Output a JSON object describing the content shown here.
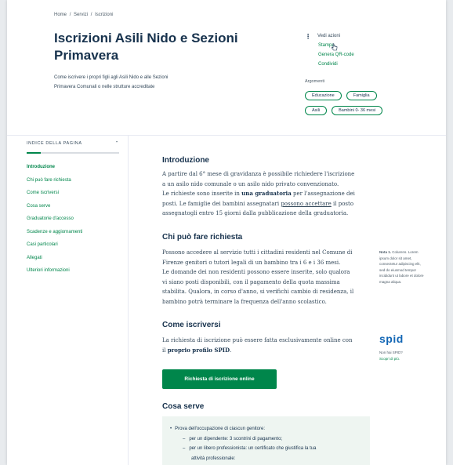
{
  "breadcrumb": [
    "Home",
    "/",
    "Servizi",
    "/",
    "Iscrizioni"
  ],
  "page": {
    "title": "Iscrizioni Asili Nido e Sezioni Primavera",
    "lead_line1": "Come iscrivere i propri figli agli Asili Nido e alle Sezioni",
    "lead_line2": "Primavera Comunali o nelle strutture accreditate"
  },
  "actions": {
    "menu_label": "Vedi azioni",
    "items": [
      "Stampa",
      "Genera QR-code",
      "Condividi"
    ]
  },
  "arguments": {
    "label": "Argomenti",
    "chips_row1": [
      "Educazione",
      "Famiglia"
    ],
    "chips_row2": [
      "Asili",
      "Bambini 0- 36 mesi"
    ]
  },
  "toc": {
    "title": "INDICE DELLA PAGINA",
    "progress": 0.15,
    "items": [
      "Introduzione",
      "Chi può fare richiesta",
      "Come iscriversi",
      "Cosa serve",
      "Graduatorie d'accesso",
      "Scadenze e aggiornamenti",
      "Casi particolari",
      "Allegati",
      "Ulteriori informazioni"
    ]
  },
  "sections": {
    "intro": {
      "heading": "Introduzione",
      "l1": "A partire dal 6° mese di gravidanza è possibile richiedere l'iscrizione",
      "l2": "a un asilo nido comunale o un asilo nido privato convenzionato.",
      "l3a": "Le richieste sono inserite in ",
      "l3b": "una graduatoria",
      "l3c": " per l'assegnazione dei",
      "l4a": "posti. Le famiglie dei bambini assegnatari ",
      "l4b": "possono accettare",
      "l4c": " il posto",
      "l5": "assegnatogli entro 15 giorni dalla pubblicazione della graduatoria."
    },
    "who": {
      "heading": "Chi può fare richiesta",
      "l1": "Possono accedere al servizio tutti i cittadini residenti nel Comune di",
      "l2": "Firenze genitori o tutori legali di un bambino tra i 6 e i 36 mesi.",
      "l3": "Le domande dei non residenti possono essere inserite, solo qualora",
      "l4": "vi siano posti disponibili, con il pagamento della quota massima",
      "l5": "stabilita. Qualora, in corso d'anno, si verifichi cambio di residenza, il",
      "l6": "bambino potrà terminare la frequenza dell'anno scolastico."
    },
    "how": {
      "heading": "Come iscriversi",
      "l1": "La richiesta di iscrizione può essere fatta esclusivamente online con",
      "l2a": "il ",
      "l2b": "proprio profilo SPID",
      "l2c": ".",
      "button": "Richiesta di iscrizione online"
    },
    "need": {
      "heading": "Cosa serve",
      "l1": "Prova dell'occupazione di ciascun genitore:",
      "l2": "per un dipendente: 3 scontrini di pagamento;",
      "l3": "per un libero professionista: un certificato che giustifica la tua",
      "l4": "attività professionale:"
    }
  },
  "note": {
    "l1a": "Nota 1.",
    "l1b": " Colurens. Lorem",
    "l2": "ipsum dolor sit amet,",
    "l3": "consectetur adipiscing elit,",
    "l4": "sed do eiusmod tempor",
    "l5": "incididunt ut labore et dolore",
    "l6": "magna aliqua."
  },
  "spid": {
    "logo": "spid",
    "line1": "Non hai SPID?",
    "line2": "Scopri di più."
  },
  "colors": {
    "accent_green": "#00864b",
    "title_blue": "#17324d",
    "spid_blue": "#1266b5"
  }
}
